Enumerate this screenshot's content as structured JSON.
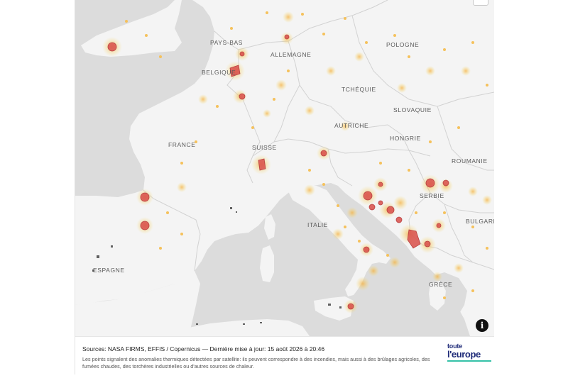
{
  "map": {
    "labels": [
      {
        "id": "pays-bas",
        "text": "PAYS-BAS"
      },
      {
        "id": "allemagne",
        "text": "ALLEMAGNE"
      },
      {
        "id": "pologne",
        "text": "POLOGNE"
      },
      {
        "id": "belgique",
        "text": "BELGIQUE"
      },
      {
        "id": "tchequie",
        "text": "TCHÉQUIE"
      },
      {
        "id": "slovaquie",
        "text": "SLOVAQUIE"
      },
      {
        "id": "autriche",
        "text": "AUTRICHE"
      },
      {
        "id": "hongrie",
        "text": "HONGRIE"
      },
      {
        "id": "france",
        "text": "FRANCE"
      },
      {
        "id": "suisse",
        "text": "SUISSE"
      },
      {
        "id": "roumanie",
        "text": "ROUMANIE"
      },
      {
        "id": "serbie",
        "text": "SERBIE"
      },
      {
        "id": "bulgarie",
        "text": "BULGARIE"
      },
      {
        "id": "italie",
        "text": "ITALIE"
      },
      {
        "id": "espagne",
        "text": "ESPAGNE"
      },
      {
        "id": "grece",
        "text": "GRÈCE"
      }
    ],
    "colors": {
      "sea": "#dcdcdc",
      "land": "#f4f4f4",
      "border": "#d4d4d4",
      "fire_large": "#d9534f",
      "fire_medium": "#f0a23a",
      "fire_small": "#f7d77a"
    },
    "info_icon": "info-icon"
  },
  "footer": {
    "sources": "Sources: NASA FIRMS, EFFIS / Copernicus — Dernière mise à jour: 15 août 2026 à 20:46",
    "note": "Les points signalent des anomalies thermiques détectées par satellite: ils peuvent correspondre à des incendies, mais aussi à des brûlages agricoles, des fumées chaudes, des torchères industrielles ou d'autres sources de chaleur.",
    "brand_line1": "toute",
    "brand_line2": "l'europe"
  }
}
